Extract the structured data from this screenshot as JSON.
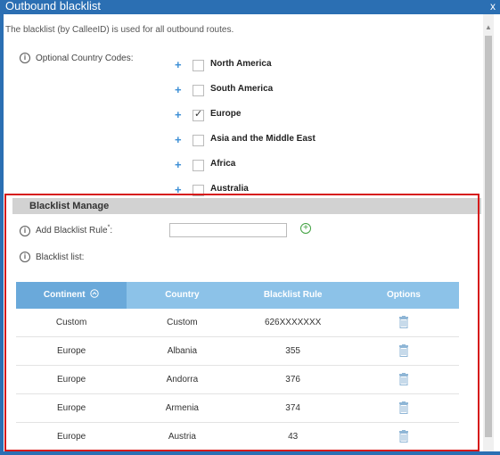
{
  "window": {
    "title": "Outbound blacklist",
    "close_label": "x"
  },
  "description": "The blacklist (by CalleeID) is used for all outbound routes.",
  "country_codes": {
    "label": "Optional Country Codes:",
    "regions": [
      {
        "name": "North America",
        "checked": false
      },
      {
        "name": "South America",
        "checked": false
      },
      {
        "name": "Europe",
        "checked": true
      },
      {
        "name": "Asia and the Middle East",
        "checked": false
      },
      {
        "name": "Africa",
        "checked": false
      },
      {
        "name": "Australia",
        "checked": false
      }
    ]
  },
  "blacklist_manage": {
    "title": "Blacklist Manage",
    "add_rule_label": "Add Blacklist Rule",
    "required_mark": "*",
    "add_rule_colon": ":",
    "add_rule_value": "",
    "list_label": "Blacklist list:"
  },
  "table": {
    "headers": [
      "Continent",
      "Country",
      "Blacklist Rule",
      "Options"
    ],
    "rows": [
      {
        "continent": "Custom",
        "country": "Custom",
        "rule": "626XXXXXXX"
      },
      {
        "continent": "Europe",
        "country": "Albania",
        "rule": "355"
      },
      {
        "continent": "Europe",
        "country": "Andorra",
        "rule": "376"
      },
      {
        "continent": "Europe",
        "country": "Armenia",
        "rule": "374"
      },
      {
        "continent": "Europe",
        "country": "Austria",
        "rule": "43"
      }
    ]
  },
  "icons": {
    "info": "info-icon",
    "plus": "plus-icon",
    "add_circle": "add-circle-icon",
    "sort": "sort-up-icon",
    "trash": "trash-icon"
  },
  "colors": {
    "titlebar": "#2b6fb3",
    "table_header": "#8cc2e8",
    "table_header_active": "#6aa9da",
    "highlight_box": "#d61a1a"
  }
}
